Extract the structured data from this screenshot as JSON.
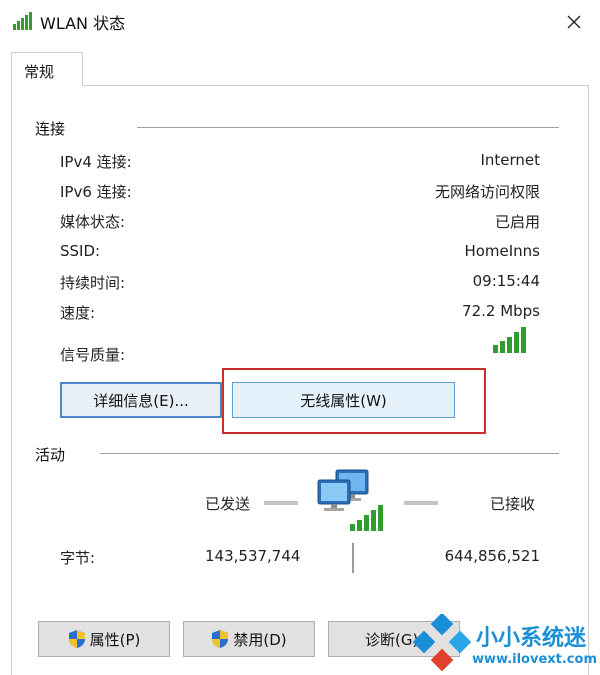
{
  "window": {
    "title": "WLAN 状态",
    "close_icon": "close-icon"
  },
  "tabs": [
    {
      "label": "常规",
      "selected": true
    }
  ],
  "connection": {
    "group_title": "连接",
    "rows": [
      {
        "label": "IPv4 连接:",
        "value": "Internet"
      },
      {
        "label": "IPv6 连接:",
        "value": "无网络访问权限"
      },
      {
        "label": "媒体状态:",
        "value": "已启用"
      },
      {
        "label": "SSID:",
        "value": "HomeInns"
      },
      {
        "label": "持续时间:",
        "value": "09:15:44"
      },
      {
        "label": "速度:",
        "value": "72.2 Mbps"
      }
    ],
    "signal_label": "信号质量:",
    "signal_icon": "wifi-signal-bars-icon",
    "buttons": {
      "details": "详细信息(E)...",
      "wireless_properties": "无线属性(W)"
    }
  },
  "activity": {
    "group_title": "活动",
    "sent_label": "已发送",
    "received_label": "已接收",
    "network_icon": "network-computers-icon",
    "bytes_label": "字节:",
    "bytes_sent": "143,537,744",
    "bytes_received": "644,856,521"
  },
  "bottom_buttons": {
    "properties": "属性(P)",
    "disable": "禁用(D)",
    "diagnose": "诊断(G)"
  },
  "watermark": {
    "brand": "小小系统迷",
    "url": "www.ilovext.com"
  },
  "colors": {
    "signal_green": "#2f9e2f",
    "highlight_red": "#c9302c",
    "focus_blue": "#4a86c8",
    "watermark_blue": "#1a8fd8"
  }
}
